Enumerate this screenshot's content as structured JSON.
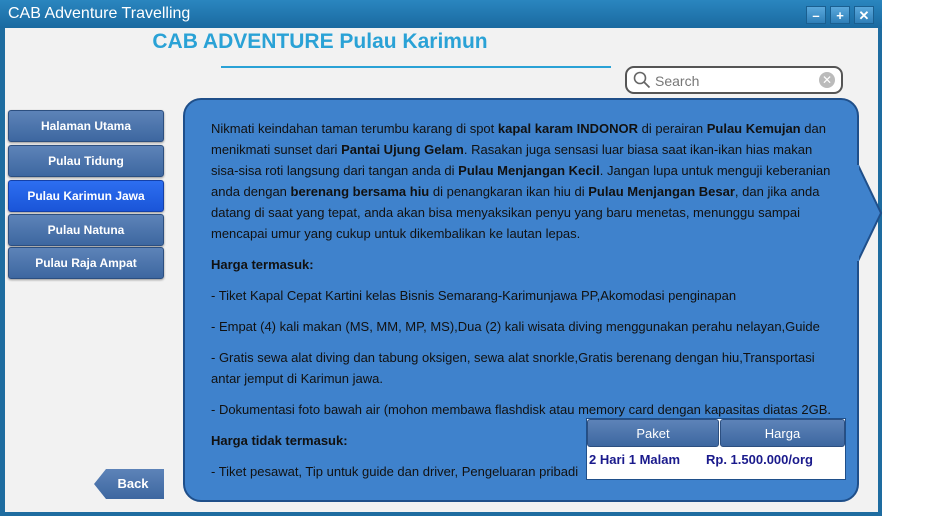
{
  "window": {
    "title": "CAB Adventure Travelling",
    "controls": [
      "–",
      "+",
      "✕"
    ]
  },
  "header": {
    "title": "CAB ADVENTURE Pulau Karimun"
  },
  "search": {
    "placeholder": "Search"
  },
  "sidebar": {
    "items": [
      {
        "label": "Halaman Utama",
        "active": false
      },
      {
        "label": "Pulau Tidung",
        "active": false
      },
      {
        "label": "Pulau Karimun Jawa",
        "active": true
      },
      {
        "label": "Pulau Natuna",
        "active": false
      },
      {
        "label": "Pulau Raja Ampat",
        "active": false
      }
    ],
    "back_label": "Back"
  },
  "content": {
    "intro": [
      {
        "t": "Nikmati keindahan taman terumbu karang di spot ",
        "b": false
      },
      {
        "t": "kapal karam INDONOR",
        "b": true
      },
      {
        "t": " di perairan ",
        "b": false
      },
      {
        "t": "Pulau Kemujan",
        "b": true
      },
      {
        "t": " dan menikmati sunset dari ",
        "b": false
      },
      {
        "t": "Pantai Ujung Gelam",
        "b": true
      },
      {
        "t": ". Rasakan juga sensasi luar biasa saat ikan-ikan hias makan sisa-sisa roti langsung dari tangan anda di ",
        "b": false
      },
      {
        "t": "Pulau Menjangan Kecil",
        "b": true
      },
      {
        "t": ". Jangan lupa untuk menguji keberanian anda dengan ",
        "b": false
      },
      {
        "t": "berenang bersama hiu",
        "b": true
      },
      {
        "t": " di penangkaran ikan hiu di ",
        "b": false
      },
      {
        "t": "Pulau Menjangan Besar",
        "b": true
      },
      {
        "t": ", dan jika anda datang di saat yang tepat, anda akan bisa menyaksikan penyu yang baru menetas, menunggu sampai mencapai umur yang cukup untuk dikembalikan ke lautan lepas.",
        "b": false
      }
    ],
    "included_title": "Harga termasuk:",
    "included": [
      "- Tiket Kapal Cepat Kartini kelas Bisnis Semarang-Karimunjawa PP,Akomodasi penginapan",
      "- Empat (4) kali makan (MS, MM, MP, MS),Dua (2) kali wisata diving menggunakan perahu nelayan,Guide",
      "- Gratis sewa alat diving dan tabung oksigen, sewa alat snorkle,Gratis berenang dengan   hiu,Transportasi antar jemput di Karimun jawa.",
      "- Dokumentasi foto bawah air (mohon membawa flashdisk atau memory card dengan kapasitas diatas 2GB."
    ],
    "excluded_title": "Harga tidak termasuk:",
    "excluded": [
      "- Tiket pesawat, Tip untuk guide dan driver, Pengeluaran pribadi"
    ]
  },
  "price_table": {
    "headers": [
      "Paket",
      "Harga"
    ],
    "row": [
      "2 Hari 1 Malam",
      "Rp. 1.500.000/org"
    ]
  }
}
